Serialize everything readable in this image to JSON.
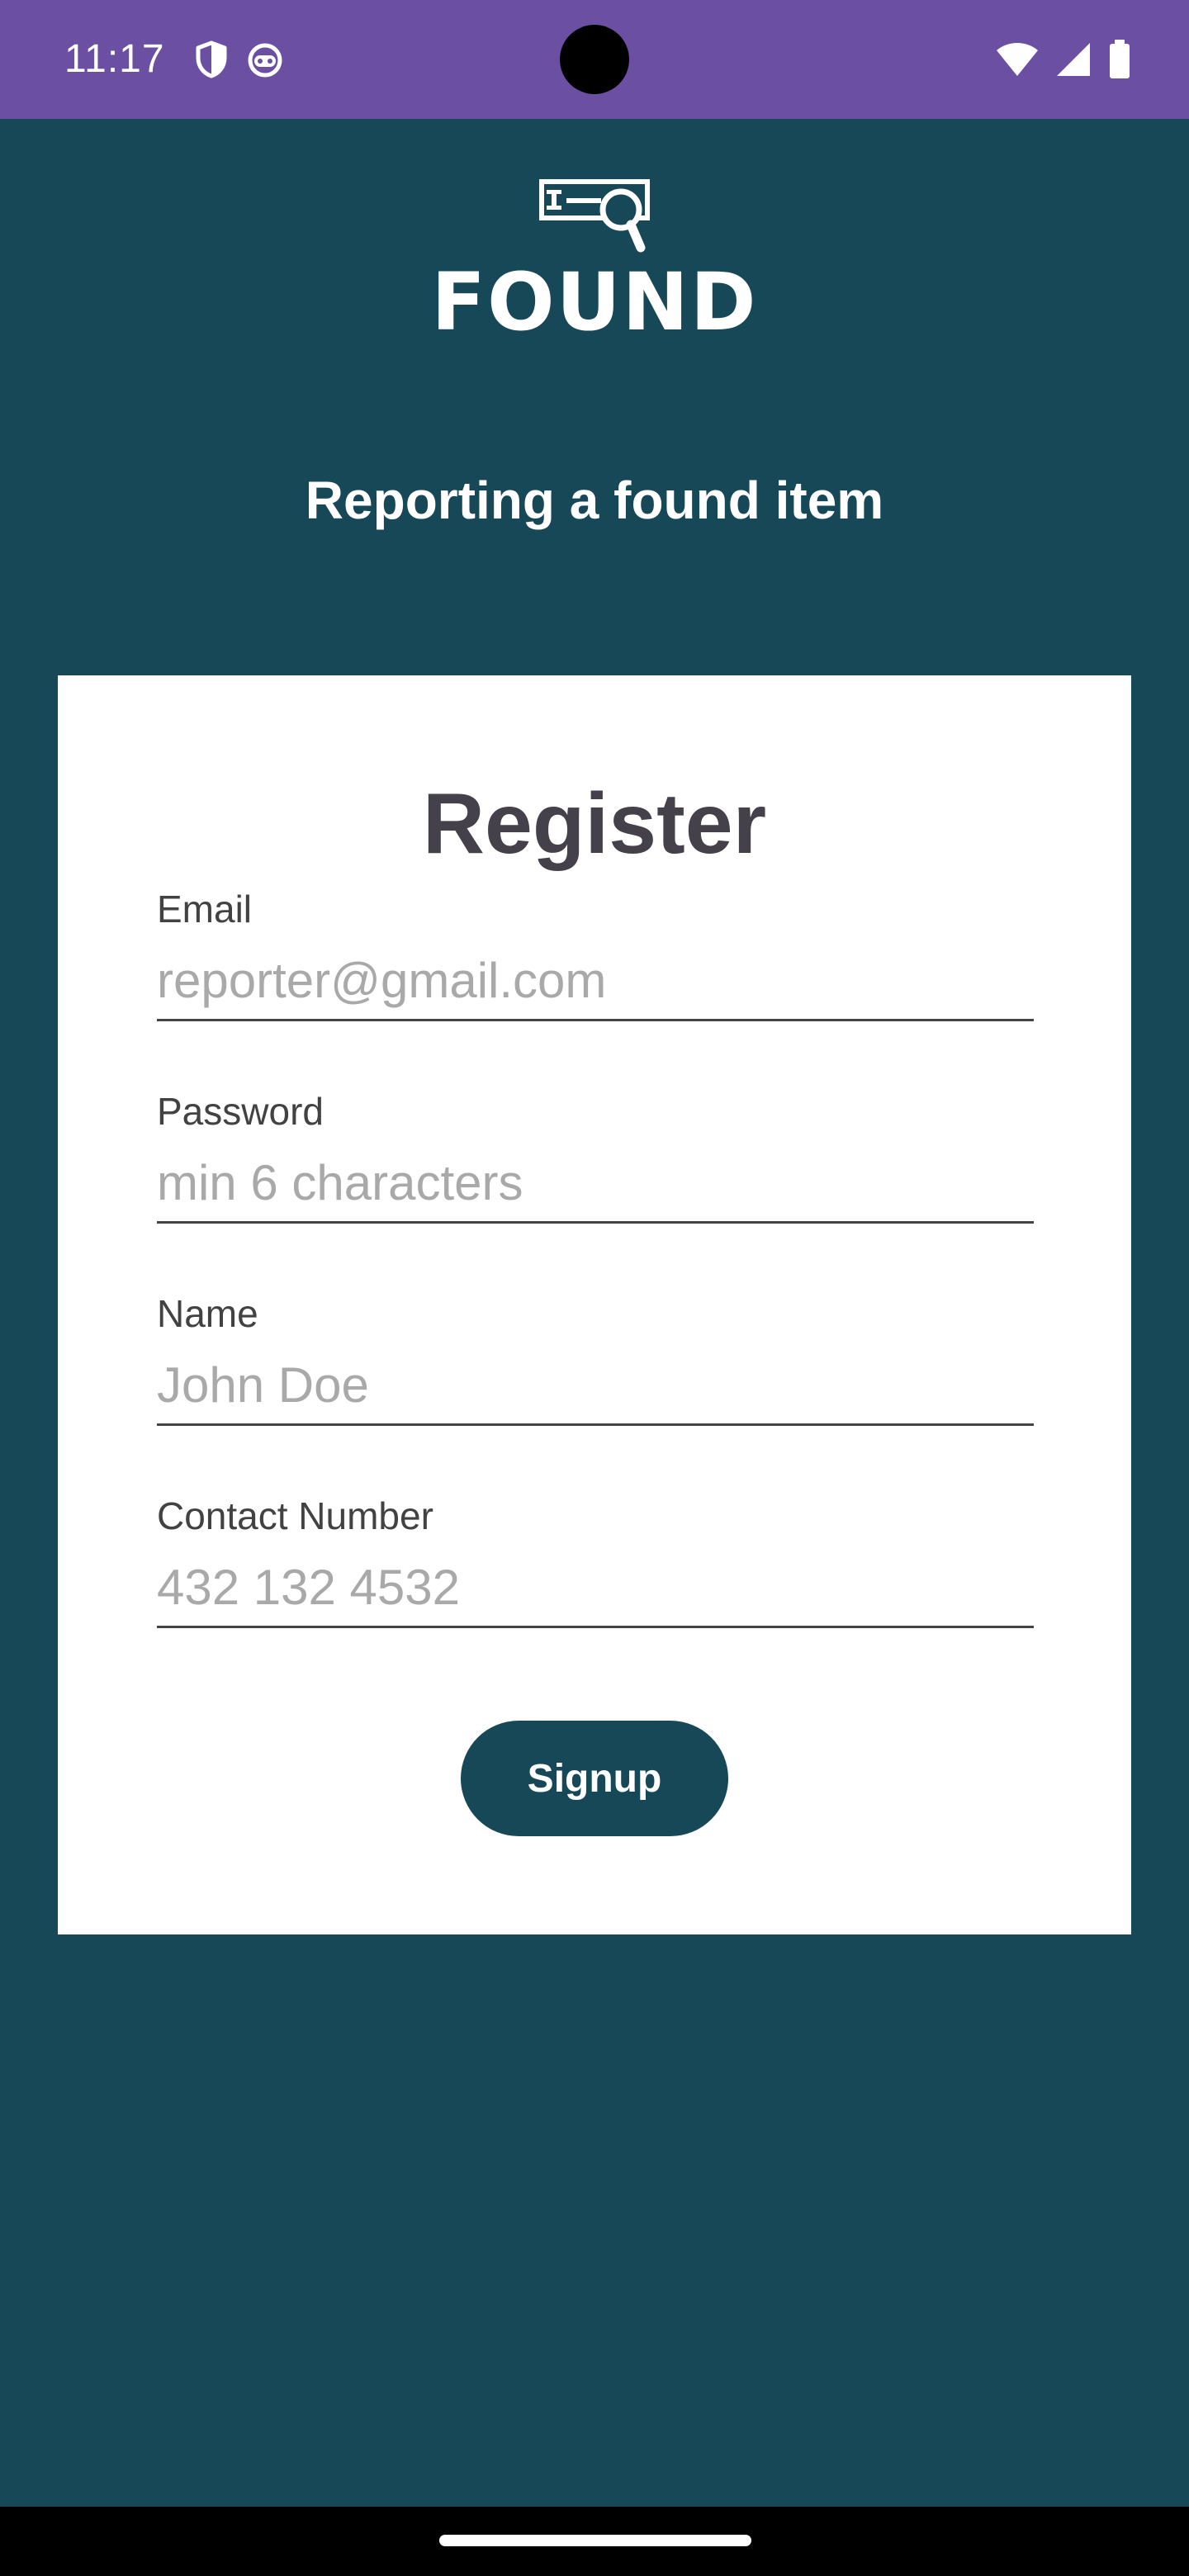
{
  "status_bar": {
    "time": "11:17",
    "icons_left": [
      "shield-icon",
      "android-face-icon"
    ],
    "icons_right": [
      "wifi-icon",
      "cell-signal-icon",
      "battery-icon"
    ],
    "background_color": "#6a4fa3"
  },
  "header": {
    "logo_text": "FOUND",
    "logo_icon": "id-card-magnifier-icon",
    "subtitle": "Reporting a found item"
  },
  "card": {
    "title": "Register",
    "fields": [
      {
        "label": "Email",
        "placeholder": "reporter@gmail.com",
        "value": ""
      },
      {
        "label": "Password",
        "placeholder": "min 6 characters",
        "value": ""
      },
      {
        "label": "Name",
        "placeholder": "John Doe",
        "value": ""
      },
      {
        "label": "Contact Number",
        "placeholder": "432 132 4532",
        "value": ""
      }
    ],
    "signup_label": "Signup"
  },
  "colors": {
    "background": "#174857",
    "card": "#ffffff",
    "title_text": "#45414b",
    "button": "#174857",
    "placeholder": "#a9a9a9"
  }
}
